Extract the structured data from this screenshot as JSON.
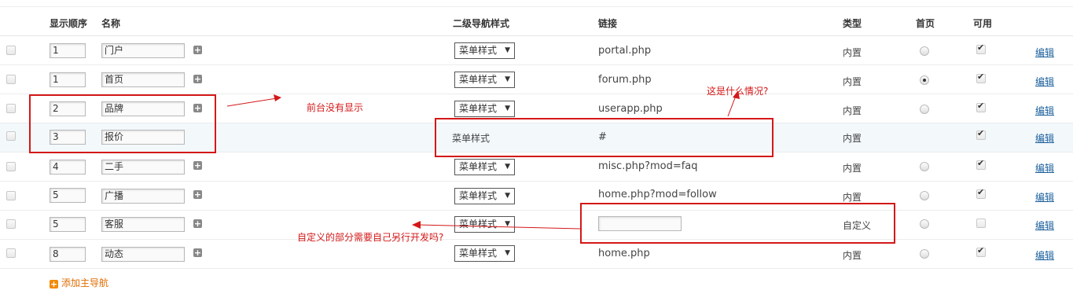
{
  "headers": {
    "order": "显示顺序",
    "name": "名称",
    "subnav_style": "二级导航样式",
    "link": "链接",
    "type": "类型",
    "home": "首页",
    "enabled": "可用"
  },
  "rows": [
    {
      "order": "1",
      "name": "门户",
      "style": "菜单样式",
      "link": "portal.php",
      "type": "内置",
      "home": false,
      "enabled": true,
      "edit": "编辑"
    },
    {
      "order": "1",
      "name": "首页",
      "style": "菜单样式",
      "link": "forum.php",
      "type": "内置",
      "home": true,
      "enabled": true,
      "edit": "编辑"
    },
    {
      "order": "2",
      "name": "品牌",
      "style": "菜单样式",
      "link": "userapp.php",
      "type": "内置",
      "home": false,
      "enabled": true,
      "edit": "编辑"
    },
    {
      "order": "3",
      "name": "报价",
      "style": "菜单样式",
      "link": "#",
      "type": "内置",
      "home": null,
      "enabled": true,
      "edit": "编辑"
    },
    {
      "order": "4",
      "name": "二手",
      "style": "菜单样式",
      "link": "misc.php?mod=faq",
      "type": "内置",
      "home": false,
      "enabled": true,
      "edit": "编辑"
    },
    {
      "order": "5",
      "name": "广播",
      "style": "菜单样式",
      "link": "home.php?mod=follow",
      "type": "内置",
      "home": false,
      "enabled": true,
      "edit": "编辑"
    },
    {
      "order": "5",
      "name": "客服",
      "style": "菜单样式",
      "link": "",
      "type": "自定义",
      "home": false,
      "enabled": false,
      "edit": "编辑"
    },
    {
      "order": "8",
      "name": "动态",
      "style": "菜单样式",
      "link": "home.php",
      "type": "内置",
      "home": false,
      "enabled": true,
      "edit": "编辑"
    }
  ],
  "add_main_nav": "添加主导航",
  "annotations": {
    "not_shown": "前台没有显示",
    "whats_this": "这是什么情况?",
    "custom_question": "自定义的部分需要自己另行开发吗?"
  },
  "colors": {
    "annotation": "#d41818",
    "link": "#1a5f9c",
    "add": "#f28a00"
  }
}
